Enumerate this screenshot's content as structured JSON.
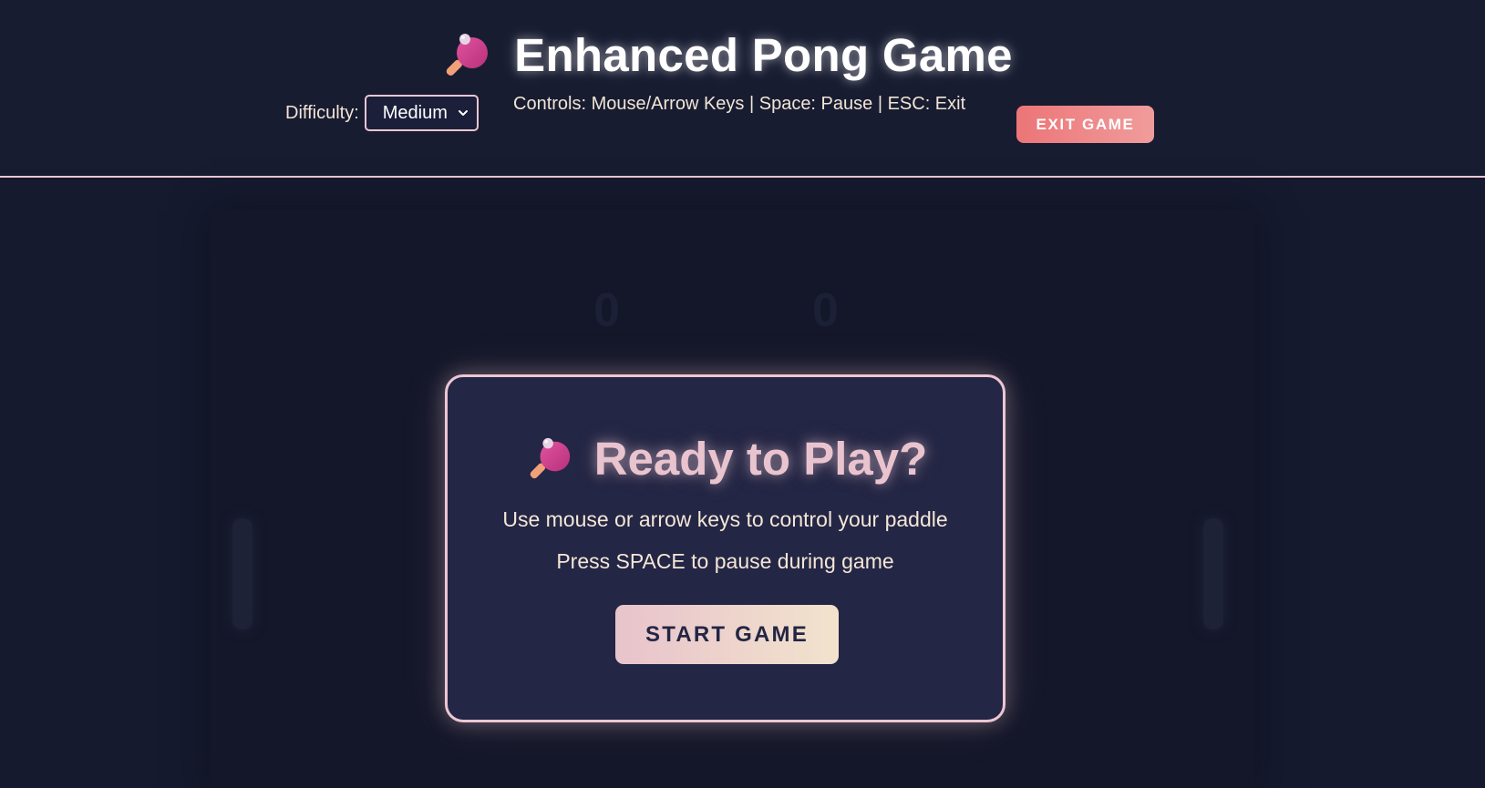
{
  "header": {
    "title": "Enhanced Pong Game",
    "title_icon": "ping-pong-paddle-icon",
    "difficulty_label": "Difficulty:",
    "difficulty_selected": "Medium",
    "controls_text": "Controls: Mouse/Arrow Keys | Space: Pause | ESC: Exit",
    "exit_label": "EXIT GAME"
  },
  "game": {
    "score_left": "0",
    "score_right": "0"
  },
  "modal": {
    "icon": "ping-pong-paddle-icon",
    "title": "Ready to Play?",
    "line1": "Use mouse or arrow keys to control your paddle",
    "line2": "Press SPACE to pause during game",
    "start_label": "START GAME"
  },
  "colors": {
    "background": "#161a2e",
    "accent_border": "#ecc6d3",
    "exit_gradient": [
      "#ec7577",
      "#f09c9c"
    ],
    "start_gradient": [
      "#e8c3cb",
      "#f2e3cd"
    ],
    "modal_bg": "#232644",
    "text_cream": "#f5e6d7"
  }
}
